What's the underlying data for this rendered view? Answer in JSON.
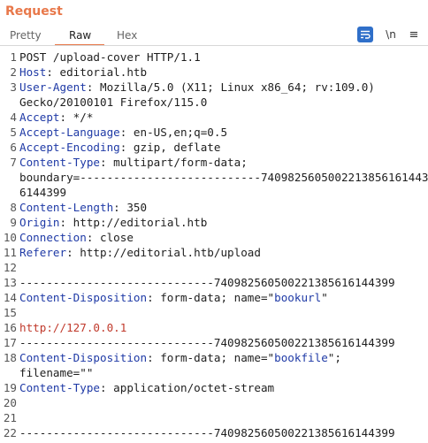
{
  "panel": {
    "title": "Request",
    "tabs": [
      {
        "label": "Pretty",
        "active": false
      },
      {
        "label": "Raw",
        "active": true
      },
      {
        "label": "Hex",
        "active": false
      }
    ],
    "toolbar": {
      "newline_label": "\\n",
      "menu_glyph": "≡"
    }
  },
  "colors": {
    "accent": "#e8784a",
    "header_key": "#1f3aa6",
    "body_value": "#c0392b"
  },
  "request_lines": [
    {
      "n": "1",
      "parts": [
        {
          "t": "POST /upload-cover HTTP/1.1",
          "c": ""
        }
      ]
    },
    {
      "n": "2",
      "parts": [
        {
          "t": "Host",
          "c": "key"
        },
        {
          "t": ": editorial.htb",
          "c": ""
        }
      ]
    },
    {
      "n": "3",
      "parts": [
        {
          "t": "User-Agent",
          "c": "key"
        },
        {
          "t": ": Mozilla/5.0 (X11; Linux x86_64; rv:109.0)",
          "c": ""
        }
      ]
    },
    {
      "n": "",
      "parts": [
        {
          "t": "Gecko/20100101 Firefox/115.0",
          "c": ""
        }
      ]
    },
    {
      "n": "4",
      "parts": [
        {
          "t": "Accept",
          "c": "key"
        },
        {
          "t": ": */*",
          "c": ""
        }
      ]
    },
    {
      "n": "5",
      "parts": [
        {
          "t": "Accept-Language",
          "c": "key"
        },
        {
          "t": ": en-US,en;q=0.5",
          "c": ""
        }
      ]
    },
    {
      "n": "6",
      "parts": [
        {
          "t": "Accept-Encoding",
          "c": "key"
        },
        {
          "t": ": gzip, deflate",
          "c": ""
        }
      ]
    },
    {
      "n": "7",
      "parts": [
        {
          "t": "Content-Type",
          "c": "key"
        },
        {
          "t": ": multipart/form-data;",
          "c": ""
        }
      ]
    },
    {
      "n": "",
      "parts": [
        {
          "t": "boundary=---------------------------740982560500221385616144399",
          "c": ""
        }
      ]
    },
    {
      "n": "",
      "parts": [
        {
          "t": "6144399",
          "c": ""
        }
      ]
    },
    {
      "n": "8",
      "parts": [
        {
          "t": "Content-Length",
          "c": "key"
        },
        {
          "t": ": 350",
          "c": ""
        }
      ]
    },
    {
      "n": "9",
      "parts": [
        {
          "t": "Origin",
          "c": "key"
        },
        {
          "t": ": http://editorial.htb",
          "c": ""
        }
      ]
    },
    {
      "n": "10",
      "parts": [
        {
          "t": "Connection",
          "c": "key"
        },
        {
          "t": ": close",
          "c": ""
        }
      ]
    },
    {
      "n": "11",
      "parts": [
        {
          "t": "Referer",
          "c": "key"
        },
        {
          "t": ": http://editorial.htb/upload",
          "c": ""
        }
      ]
    },
    {
      "n": "12",
      "parts": []
    },
    {
      "n": "13",
      "parts": [
        {
          "t": "-----------------------------740982560500221385616144399",
          "c": ""
        }
      ]
    },
    {
      "n": "14",
      "parts": [
        {
          "t": "Content-Disposition",
          "c": "key"
        },
        {
          "t": ": form-data; name=\"",
          "c": ""
        },
        {
          "t": "bookurl",
          "c": "key"
        },
        {
          "t": "\"",
          "c": ""
        }
      ]
    },
    {
      "n": "15",
      "parts": []
    },
    {
      "n": "16",
      "parts": [
        {
          "t": "http://127.0.0.1",
          "c": "red"
        }
      ]
    },
    {
      "n": "17",
      "parts": [
        {
          "t": "-----------------------------740982560500221385616144399",
          "c": ""
        }
      ]
    },
    {
      "n": "18",
      "parts": [
        {
          "t": "Content-Disposition",
          "c": "key"
        },
        {
          "t": ": form-data; name=\"",
          "c": ""
        },
        {
          "t": "bookfile",
          "c": "key"
        },
        {
          "t": "\";",
          "c": ""
        }
      ]
    },
    {
      "n": "",
      "parts": [
        {
          "t": "filename=\"\"",
          "c": ""
        }
      ]
    },
    {
      "n": "19",
      "parts": [
        {
          "t": "Content-Type",
          "c": "key"
        },
        {
          "t": ": application/octet-stream",
          "c": ""
        }
      ]
    },
    {
      "n": "20",
      "parts": []
    },
    {
      "n": "21",
      "parts": []
    },
    {
      "n": "22",
      "parts": [
        {
          "t": "-----------------------------740982560500221385616144399",
          "c": ""
        }
      ]
    }
  ]
}
